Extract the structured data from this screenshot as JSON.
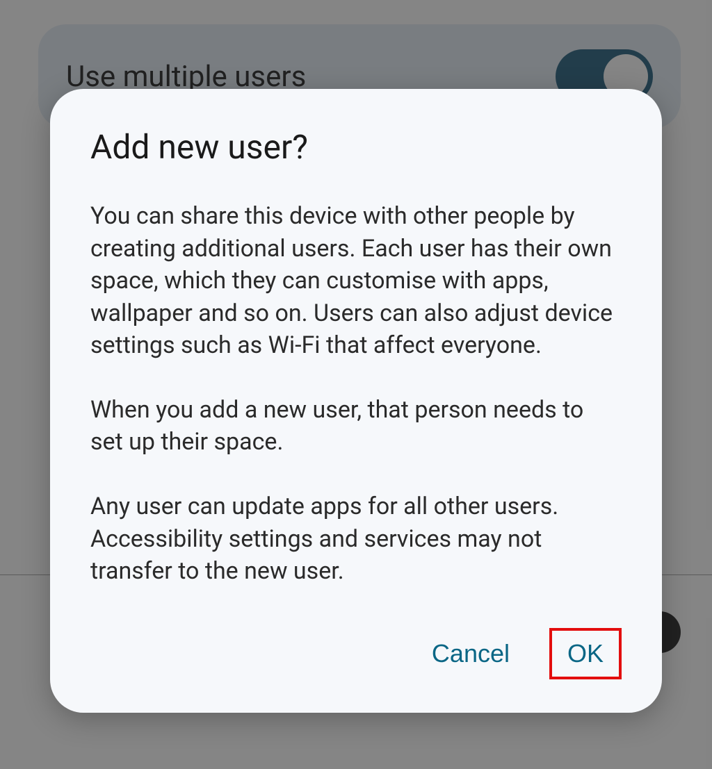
{
  "background": {
    "setting_label": "Use multiple users"
  },
  "dialog": {
    "title": "Add new user?",
    "para1": "You can share this device with other people by creating additional users. Each user has their own space, which they can customise with apps, wallpaper and so on. Users can also adjust device settings such as Wi-Fi that affect everyone.",
    "para2": "When you add a new user, that person needs to set up their space.",
    "para3": "Any user can update apps for all other users. Accessibility settings and services may not transfer to the new user.",
    "cancel_label": "Cancel",
    "ok_label": "OK"
  }
}
